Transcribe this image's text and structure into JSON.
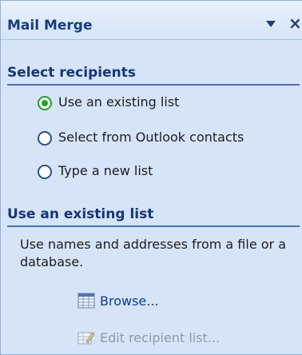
{
  "pane": {
    "title": "Mail Merge"
  },
  "select_recipients": {
    "heading": "Select recipients",
    "options": [
      {
        "label": "Use an existing list",
        "selected": true
      },
      {
        "label": "Select from Outlook contacts",
        "selected": false
      },
      {
        "label": "Type a new list",
        "selected": false
      }
    ]
  },
  "existing_list": {
    "heading": "Use an existing list",
    "description": "Use names and addresses from a file or a database.",
    "actions": [
      {
        "label": "Browse...",
        "enabled": true,
        "icon": "table-icon"
      },
      {
        "label": "Edit recipient list...",
        "enabled": false,
        "icon": "edit-list-icon"
      }
    ]
  }
}
